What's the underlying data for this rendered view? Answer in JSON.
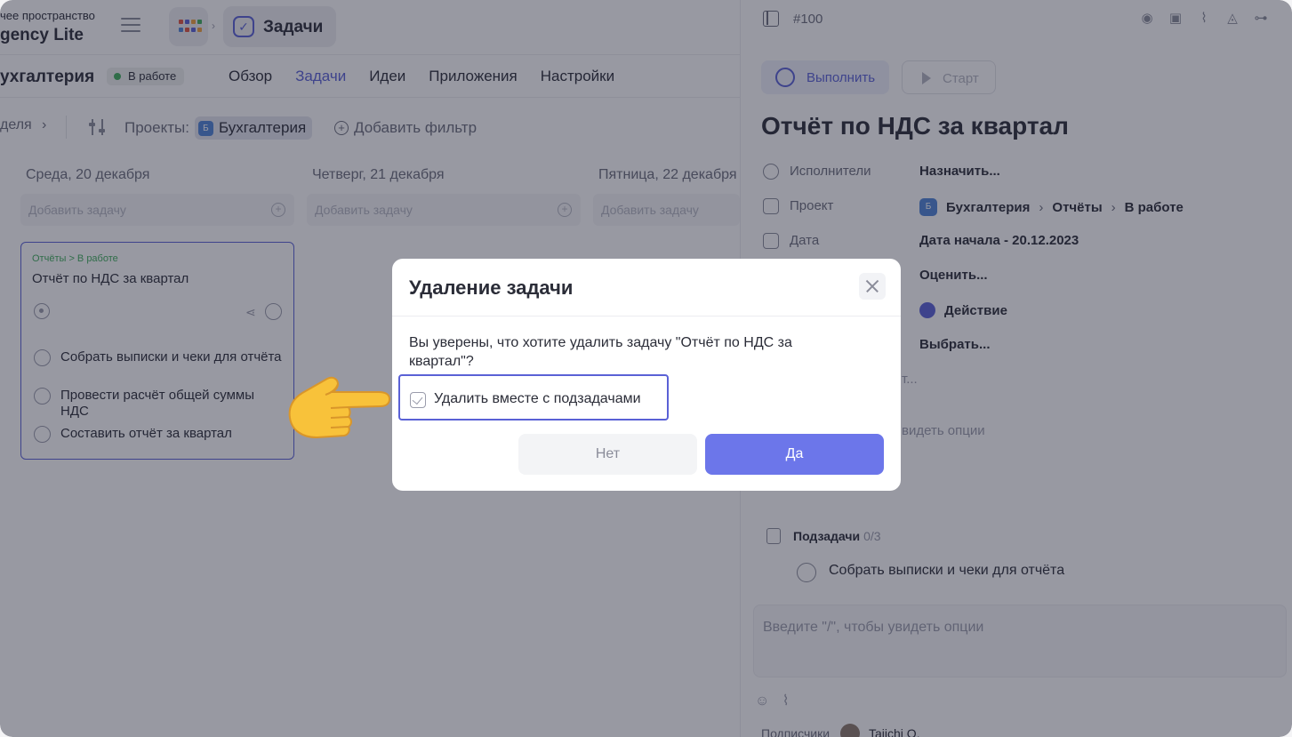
{
  "colors": {
    "accent": "#5a61d6",
    "primary_button": "#6c76ea",
    "status_green": "#3fae5c",
    "overlay": "rgba(31,33,52,0.46)"
  },
  "header": {
    "workspace_sub": "чее пространство",
    "workspace_name": "gency Lite",
    "apps_icon": "grid-icon",
    "section_label": "Задачи"
  },
  "project": {
    "name": "ухгалтерия",
    "status": "В работе",
    "nav": [
      "Обзор",
      "Задачи",
      "Идеи",
      "Приложения",
      "Настройки"
    ],
    "active_nav": "Задачи"
  },
  "filters": {
    "week": "деля",
    "projects_label": "Проекты:",
    "project_avatar": "Б",
    "project_chip": "Бухгалтерия",
    "add_filter": "Добавить фильтр"
  },
  "calendar": {
    "columns": [
      {
        "title": "Среда, 20 декабря",
        "placeholder": "Добавить задачу"
      },
      {
        "title": "Четверг, 21 декабря",
        "placeholder": "Добавить задачу"
      },
      {
        "title": "Пятница, 22 декабря",
        "placeholder": "Добавить задачу"
      }
    ],
    "card": {
      "crumb": "Отчёты > В работе",
      "title": "Отчёт по НДС за квартал",
      "subtasks": [
        "Собрать выписки и чеки для отчёта",
        "Провести расчёт общей суммы НДС",
        "Составить отчёт за квартал"
      ]
    }
  },
  "panel": {
    "task_id": "#100",
    "toolbar_icons": [
      "eye-icon",
      "lock-icon",
      "paperclip-icon",
      "bell-icon",
      "hierarchy-icon"
    ],
    "complete_label": "Выполнить",
    "start_label": "Старт",
    "title": "Отчёт по НДС за квартал",
    "rows": [
      {
        "key": "Исполнители",
        "value": "Назначить..."
      },
      {
        "key": "Проект",
        "project": "Бухгалтерия",
        "folder": "Отчёты",
        "stage": "В работе"
      },
      {
        "key": "Дата",
        "value": "Дата начала  -  20.12.2023"
      },
      {
        "value": "Оценить..."
      },
      {
        "value": "Действие"
      },
      {
        "value": "Выбрать..."
      }
    ],
    "faded_1": "т...",
    "faded_2": "видеть опции",
    "subtasks_label": "Подзадачи",
    "subtasks_count": "0/3",
    "subtask_item": "Собрать выписки и чеки для отчёта",
    "comment_placeholder": "Введите \"/\", чтобы увидеть опции",
    "subscribers_label": "Подписчики",
    "subscriber_name": "Taiichi O."
  },
  "modal": {
    "title": "Удаление задачи",
    "message": "Вы уверены, что хотите удалить задачу \"Отчёт по НДС за квартал\"?",
    "checkbox_label": "Удалить вместе с подзадачами",
    "checkbox_checked": true,
    "no_label": "Нет",
    "yes_label": "Да"
  }
}
